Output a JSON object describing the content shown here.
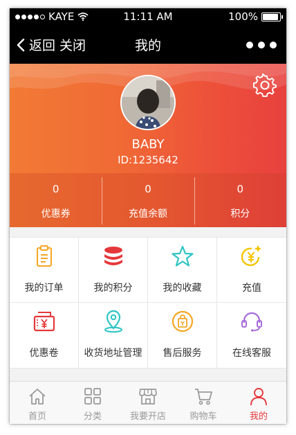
{
  "status_bar": {
    "carrier": "KAYE",
    "time": "11:11 AM",
    "battery": "100%",
    "battery_level": 1.0
  },
  "nav": {
    "back": "返回",
    "close": "关闭",
    "title": "我的"
  },
  "profile": {
    "name": "BABY",
    "id": "ID:1235642"
  },
  "stats": [
    {
      "value": "0",
      "label": "优惠券"
    },
    {
      "value": "0",
      "label": "充值余额"
    },
    {
      "value": "0",
      "label": "积分"
    }
  ],
  "menu": [
    {
      "label": "我的订单",
      "icon": "clipboard-icon",
      "color": "#f5a623"
    },
    {
      "label": "我的积分",
      "icon": "coins-stack-icon",
      "color": "#e5383b"
    },
    {
      "label": "我的收藏",
      "icon": "star-icon",
      "color": "#2ec4c4"
    },
    {
      "label": "充值",
      "icon": "yen-coin-plus-icon",
      "color": "#f5c400"
    },
    {
      "label": "优惠卷",
      "icon": "coupon-icon",
      "color": "#e5383b"
    },
    {
      "label": "收货地址管理",
      "icon": "location-pin-icon",
      "color": "#2ec4c4"
    },
    {
      "label": "售后服务",
      "icon": "shopping-bag-icon",
      "color": "#f5a623"
    },
    {
      "label": "在线客服",
      "icon": "headset-icon",
      "color": "#a66bd8"
    }
  ],
  "tabs": [
    {
      "label": "首页",
      "icon": "home-icon",
      "active": false
    },
    {
      "label": "分类",
      "icon": "category-grid-icon",
      "active": false
    },
    {
      "label": "我要开店",
      "icon": "store-icon",
      "active": false
    },
    {
      "label": "购物车",
      "icon": "cart-icon",
      "active": false
    },
    {
      "label": "我的",
      "icon": "user-icon",
      "active": true
    }
  ],
  "colors": {
    "accent": "#e5383b",
    "header_start": "#f27a35",
    "header_end": "#e8413e"
  }
}
